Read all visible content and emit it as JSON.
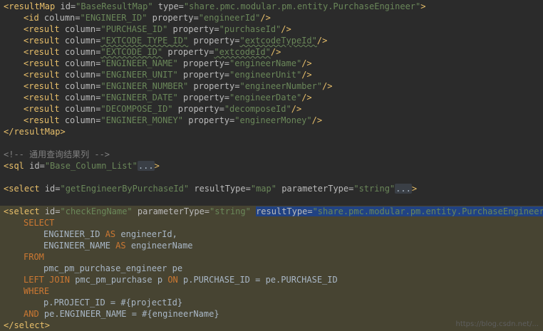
{
  "lines": {
    "l1": {
      "open": "<resultMap",
      "a1": "id=",
      "v1": "\"BaseResultMap\"",
      "a2": "type=",
      "v2": "\"share.pmc.modular.pm.entity.PurchaseEngineer\"",
      "close": ">"
    },
    "l2": {
      "open": "<id",
      "a1": "column=",
      "v1": "\"ENGINEER_ID\"",
      "a2": "property=",
      "v2": "\"engineerId\"",
      "close": "/>"
    },
    "l3": {
      "open": "<result",
      "a1": "column=",
      "v1": "\"PURCHASE_ID\"",
      "a2": "property=",
      "v2": "\"purchaseId\"",
      "close": "/>"
    },
    "l4": {
      "open": "<result",
      "a1": "column=",
      "v1": "\"EXTCODE_TYPE_ID\"",
      "a2": "property=",
      "v2": "\"extcodeTypeId\"",
      "close": "/>"
    },
    "l5": {
      "open": "<result",
      "a1": "column=",
      "v1": "\"EXTCODE_ID\"",
      "a2": "property=",
      "v2": "\"extcodeId\"",
      "close": "/>"
    },
    "l6": {
      "open": "<result",
      "a1": "column=",
      "v1": "\"ENGINEER_NAME\"",
      "a2": "property=",
      "v2": "\"engineerName\"",
      "close": "/>"
    },
    "l7": {
      "open": "<result",
      "a1": "column=",
      "v1": "\"ENGINEER_UNIT\"",
      "a2": "property=",
      "v2": "\"engineerUnit\"",
      "close": "/>"
    },
    "l8": {
      "open": "<result",
      "a1": "column=",
      "v1": "\"ENGINEER_NUMBER\"",
      "a2": "property=",
      "v2": "\"engineerNumber\"",
      "close": "/>"
    },
    "l9": {
      "open": "<result",
      "a1": "column=",
      "v1": "\"ENGINEER_DATE\"",
      "a2": "property=",
      "v2": "\"engineerDate\"",
      "close": "/>"
    },
    "l10": {
      "open": "<result",
      "a1": "column=",
      "v1": "\"DECOMPOSE_ID\"",
      "a2": "property=",
      "v2": "\"decomposeId\"",
      "close": "/>"
    },
    "l11": {
      "open": "<result",
      "a1": "column=",
      "v1": "\"ENGINEER_MONEY\"",
      "a2": "property=",
      "v2": "\"engineerMoney\"",
      "close": "/>"
    },
    "l12": {
      "close": "</resultMap>"
    },
    "l14": {
      "comment": "<!-- 通用查询结果列 -->"
    },
    "l15": {
      "open": "<sql",
      "a1": "id=",
      "v1": "\"Base_Column_List\"",
      "fold": "...",
      "close": ">"
    },
    "l17": {
      "open": "<select",
      "a1": "id=",
      "v1": "\"getEngineerByPurchaseId\"",
      "a2": "resultType=",
      "v2": "\"map\"",
      "a3": "parameterType=",
      "v3": "\"string\"",
      "fold": "...",
      "close": ">"
    },
    "l19": {
      "open": "<select",
      "a1": "id=",
      "v1": "\"checkEngName\"",
      "a2": "parameterType=",
      "v2": "\"string\"",
      "a3": "resultType=",
      "v3": "\"share.pmc.modular.pm.entity.PurchaseEngineer\"",
      "close": ">"
    },
    "l20": {
      "kw": "SELECT"
    },
    "l21": {
      "t1": "ENGINEER_ID ",
      "kw": "AS",
      "t2": " engineerId,"
    },
    "l22": {
      "t1": "ENGINEER_NAME ",
      "kw": "AS",
      "t2": " engineerName"
    },
    "l23": {
      "kw": "FROM"
    },
    "l24": {
      "t1": "pmc_pm_purchase_engineer pe"
    },
    "l25": {
      "kw1": "LEFT JOIN",
      "t1": " pmc_pm_purchase p ",
      "kw2": "ON",
      "t2": " p.PURCHASE_ID = pe.PURCHASE_ID"
    },
    "l26": {
      "kw": "WHERE"
    },
    "l27": {
      "t1": "p.PROJECT_ID = #{projectId}"
    },
    "l28": {
      "kw": "AND",
      "t1": " pe.ENGINEER_NAME = #{engineerName}"
    },
    "l29": {
      "close": "</select>"
    }
  },
  "watermark": "https://blog.csdn.net/..."
}
